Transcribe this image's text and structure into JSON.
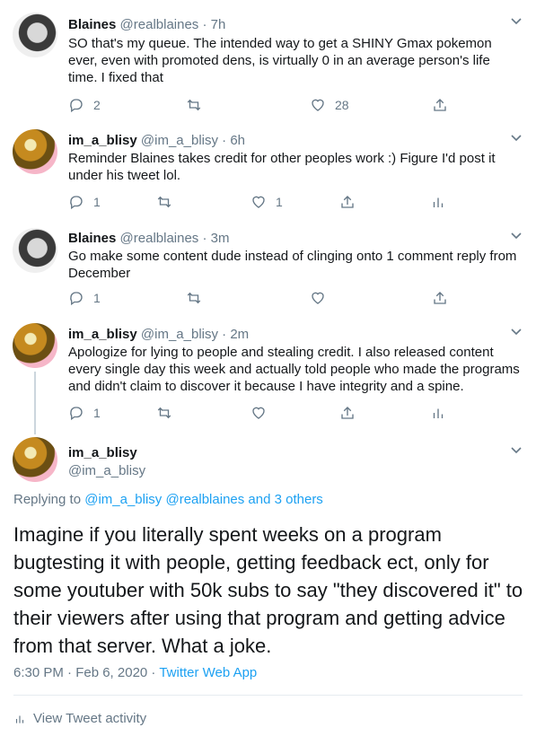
{
  "replies": [
    {
      "name": "Blaines",
      "handle": "@realblaines",
      "time": "· 7h",
      "text": "SO that's my queue. The intended way to get a SHINY Gmax pokemon ever, even with promoted dens, is virtually 0 in an average person's life time. I fixed that",
      "reply_count": "2",
      "retweet_count": "",
      "like_count": "28",
      "last_action_icon": "share-icon"
    },
    {
      "name": "im_a_blisy",
      "handle": "@im_a_blisy",
      "time": "· 6h",
      "text": "Reminder Blaines takes credit for other peoples work :) Figure I'd post it under his tweet lol.",
      "reply_count": "1",
      "retweet_count": "",
      "like_count": "1",
      "last_action_icon": "analytics-icon"
    },
    {
      "name": "Blaines",
      "handle": "@realblaines",
      "time": "· 3m",
      "text": "Go make some content dude instead of clinging onto 1 comment reply from December",
      "reply_count": "1",
      "retweet_count": "",
      "like_count": "",
      "last_action_icon": "share-icon"
    },
    {
      "name": "im_a_blisy",
      "handle": "@im_a_blisy",
      "time": "· 2m",
      "text": "Apologize for lying to people and stealing credit. I also released content every single day this week and actually told people who made the programs and didn't claim to discover it because I have integrity and a spine.",
      "reply_count": "1",
      "retweet_count": "",
      "like_count": "",
      "last_action_icon": "analytics-icon"
    }
  ],
  "main_tweet": {
    "name": "im_a_blisy",
    "handle": "@im_a_blisy",
    "replying_prefix": "Replying to",
    "replying_links": "@im_a_blisy @realblaines and 3 others",
    "text": "Imagine if you literally spent weeks on a program bugtesting it with people, getting feedback ect, only for some youtuber with 50k subs to say \"they discovered it\" to their viewers after using that program and getting advice from that server. What a joke.",
    "timestamp": "6:30 PM · Feb 6, 2020 ·",
    "source": "Twitter Web App",
    "activity_label": "View Tweet activity"
  },
  "colors": {
    "text": "#14171a",
    "secondary": "#657786",
    "link": "#1da1f2",
    "divider": "#e6ecf0"
  }
}
